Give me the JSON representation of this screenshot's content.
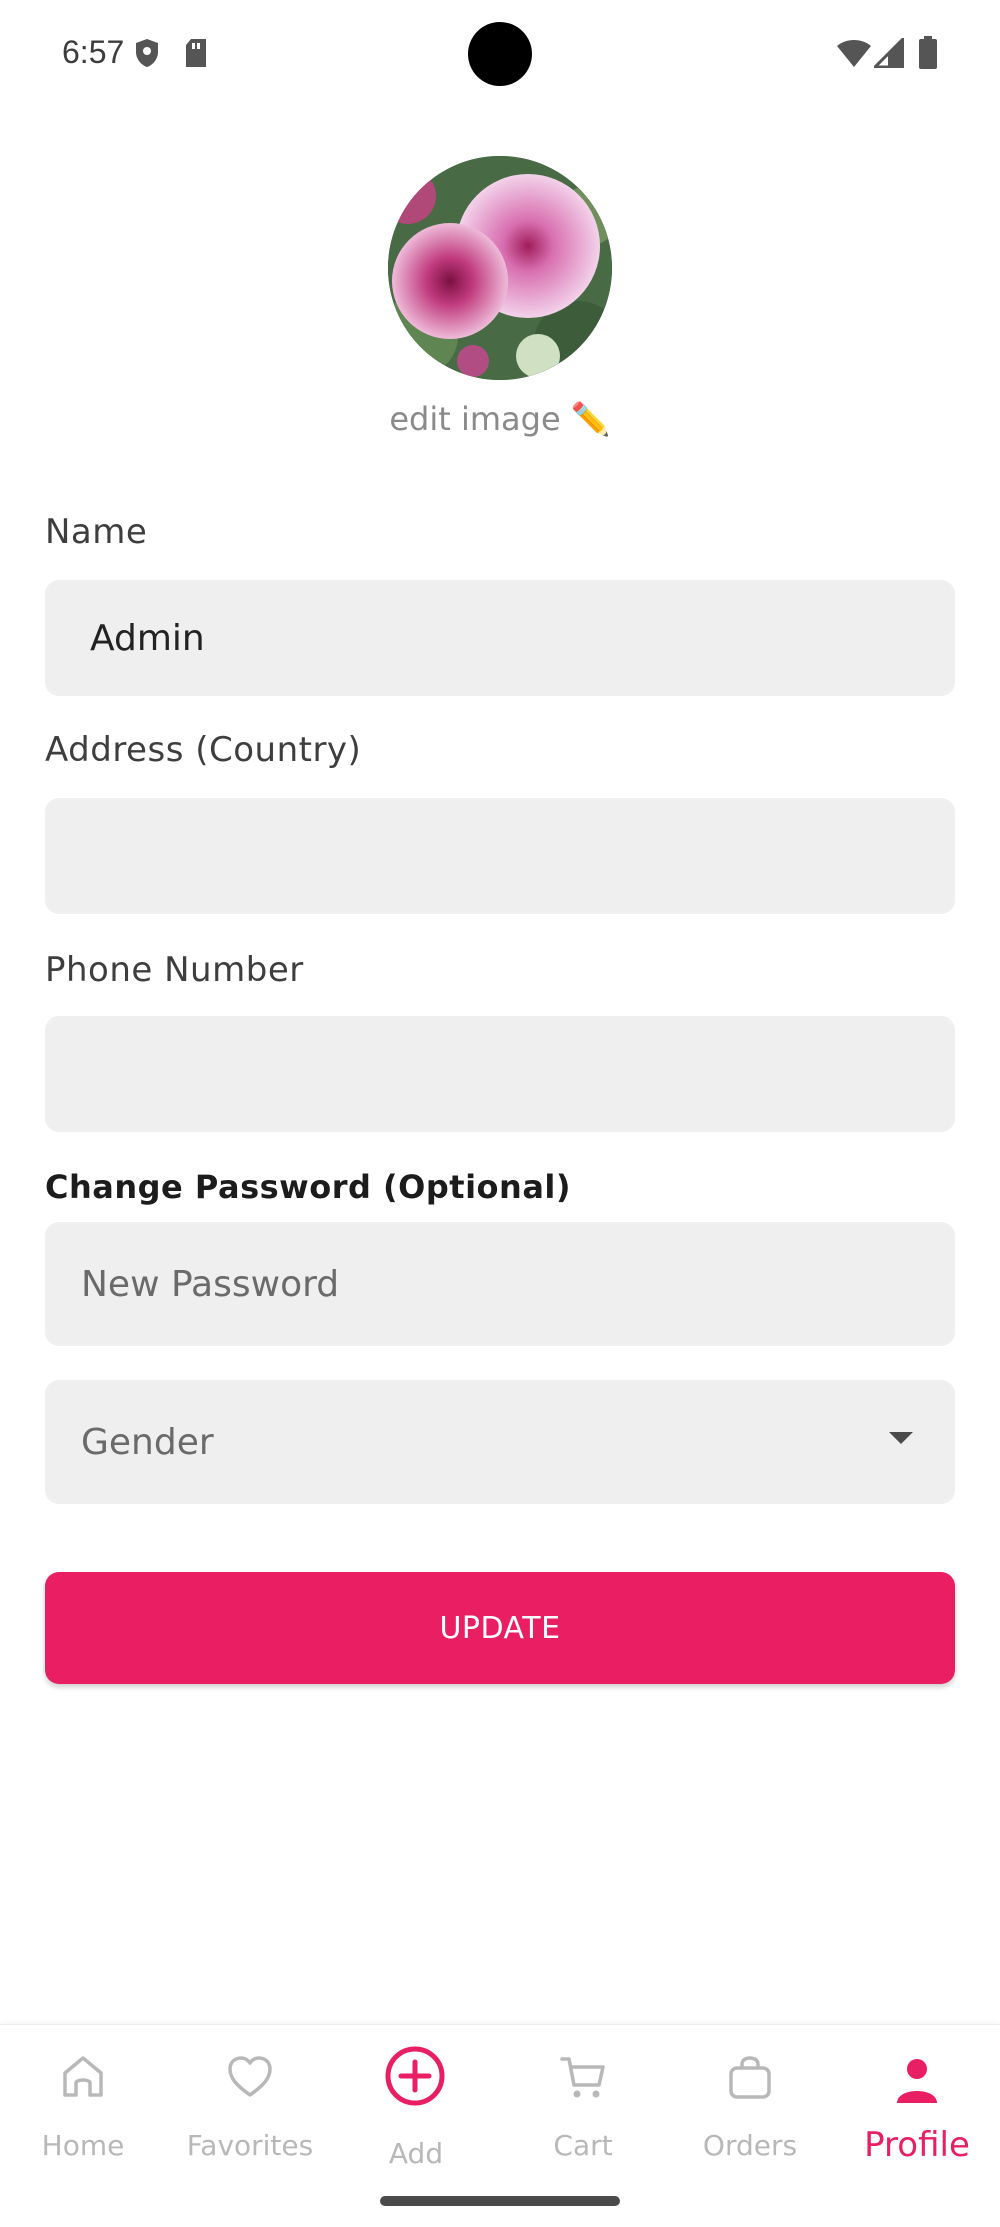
{
  "status_bar": {
    "time": "6:57"
  },
  "profile": {
    "edit_image_label": "edit image ✏️"
  },
  "form": {
    "name_label": "Name",
    "name_value": "Admin",
    "address_label": "Address (Country)",
    "address_value": "",
    "phone_label": "Phone Number",
    "phone_value": "",
    "change_password_label": "Change Password (Optional)",
    "new_password_placeholder": "New Password",
    "gender_placeholder": "Gender",
    "update_button": "UPDATE"
  },
  "bottom_nav": {
    "items": [
      {
        "label": "Home",
        "icon": "home-icon",
        "active": false
      },
      {
        "label": "Favorites",
        "icon": "heart-icon",
        "active": false
      },
      {
        "label": "Add",
        "icon": "add-circle-icon",
        "active": false
      },
      {
        "label": "Cart",
        "icon": "cart-icon",
        "active": false
      },
      {
        "label": "Orders",
        "icon": "bag-icon",
        "active": false
      },
      {
        "label": "Profile",
        "icon": "person-icon",
        "active": true
      }
    ]
  },
  "colors": {
    "accent": "#e91e63",
    "field_bg": "#efefef",
    "inactive_nav": "#b8b8b8"
  }
}
